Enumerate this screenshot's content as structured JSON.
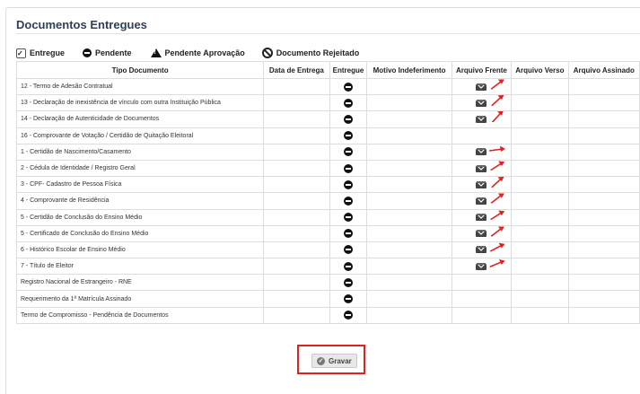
{
  "section": {
    "title": "Documentos Entregues"
  },
  "legend": {
    "delivered": "Entregue",
    "pending": "Pendente",
    "pending_approval": "Pendente Aprovação",
    "rejected": "Documento Rejeitado"
  },
  "table": {
    "headers": [
      "Tipo Documento",
      "Data de Entrega",
      "Entregue",
      "Motivo Indeferimento",
      "Arquivo Frente",
      "Arquivo Verso",
      "Arquivo Assinado"
    ],
    "rows": [
      {
        "tipo": "12 - Termo de Adesão Contratual",
        "status": "pendente",
        "frente": true
      },
      {
        "tipo": "13 - Declaração de inexistência de vínculo com outra Instituição Pública",
        "status": "pendente",
        "frente": true
      },
      {
        "tipo": "14 - Declaração de Autenticidade de Documentos",
        "status": "pendente",
        "frente": true
      },
      {
        "tipo": "16 - Comprovante de Votação / Certidão de Quitação Eleitoral",
        "status": "pendente",
        "frente": false
      },
      {
        "tipo": "1 - Certidão de Nascimento/Casamento",
        "status": "pendente",
        "frente": true
      },
      {
        "tipo": "2 - Cédula de Identidade / Registro Geral",
        "status": "pendente",
        "frente": true
      },
      {
        "tipo": "3 - CPF- Cadastro de Pessoa Física",
        "status": "pendente",
        "frente": true
      },
      {
        "tipo": "4 - Comprovante de Residência",
        "status": "pendente",
        "frente": true
      },
      {
        "tipo": "5 - Certidão de Conclusão do Ensino Médio",
        "status": "pendente",
        "frente": true
      },
      {
        "tipo": "5 - Certificado de Conclusão do Ensino Médio",
        "status": "pendente",
        "frente": true
      },
      {
        "tipo": "6 - Histórico Escolar de Ensino Médio",
        "status": "pendente",
        "frente": true
      },
      {
        "tipo": "7 - Título de Eleitor",
        "status": "pendente",
        "frente": true
      },
      {
        "tipo": "Registro Nacional de Estrangeiro - RNE",
        "status": "pendente",
        "frente": false
      },
      {
        "tipo": "Requerimento da 1ª Matrícula Assinado",
        "status": "pendente",
        "frente": false
      },
      {
        "tipo": "Termo de Compromisso - Pendência de Documentos",
        "status": "pendente",
        "frente": false
      }
    ]
  },
  "actions": {
    "save_label": "Gravar"
  },
  "colors": {
    "highlight": "#e12020",
    "title": "#2f3f55"
  }
}
